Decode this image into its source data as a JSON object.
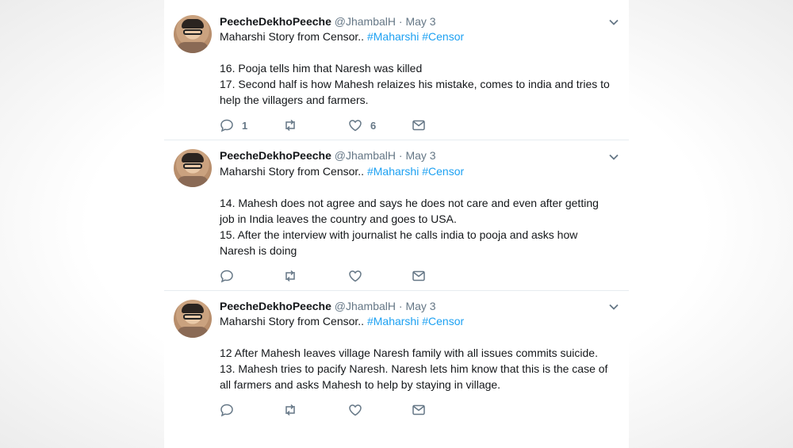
{
  "tweets": [
    {
      "name": "PeecheDekhoPeeche",
      "handle": "@JhambalH",
      "separator": "·",
      "date": "May 3",
      "subtitle_text": "Maharshi Story from Censor..",
      "hashtags": [
        "#Maharshi",
        "#Censor"
      ],
      "lines": [
        "16. Pooja tells him that Naresh was killed",
        "17. Second half is how Mahesh relaizes his mistake, comes to india and tries to help the villagers and farmers."
      ],
      "reply_count": "1",
      "retweet_count": "",
      "like_count": "6"
    },
    {
      "name": "PeecheDekhoPeeche",
      "handle": "@JhambalH",
      "separator": "·",
      "date": "May 3",
      "subtitle_text": "Maharshi Story from Censor..",
      "hashtags": [
        "#Maharshi",
        "#Censor"
      ],
      "lines": [
        "14. Mahesh does not agree and says he does not care and even after getting job in India leaves the country and goes to USA.",
        "15. After the interview with journalist he calls india to pooja and asks how Naresh is doing"
      ],
      "reply_count": "",
      "retweet_count": "",
      "like_count": ""
    },
    {
      "name": "PeecheDekhoPeeche",
      "handle": "@JhambalH",
      "separator": "·",
      "date": "May 3",
      "subtitle_text": "Maharshi Story from Censor..",
      "hashtags": [
        "#Maharshi",
        "#Censor"
      ],
      "lines": [
        "12 After Mahesh leaves village Naresh family with all issues commits suicide.",
        "13. Mahesh tries to pacify Naresh. Naresh lets him know that this is the case of all farmers and asks Mahesh to help by staying in village."
      ],
      "reply_count": "",
      "retweet_count": "",
      "like_count": ""
    }
  ],
  "icons": {
    "reply": "reply-icon",
    "retweet": "retweet-icon",
    "like": "heart-icon",
    "dm": "envelope-icon",
    "menu": "chevron-down-icon"
  },
  "colors": {
    "hashtag": "#1da1f2",
    "muted": "#657786",
    "text": "#14171a",
    "divider": "#e6ecf0"
  }
}
